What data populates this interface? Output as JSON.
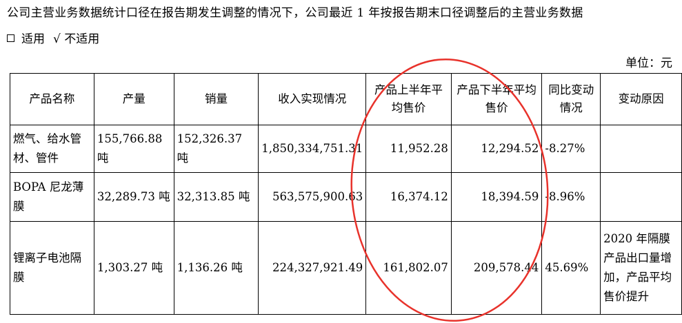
{
  "intro": "公司主营业务数据统计口径在报告期发生调整的情况下，公司最近 1 年按报告期末口径调整后的主营业务数据",
  "options": {
    "applicable_box": "□",
    "applicable": "适用",
    "not_applicable_mark": "√",
    "not_applicable": "不适用"
  },
  "unit_label": "单位：元",
  "table": {
    "headers": [
      "产品名称",
      "产量",
      "销量",
      "收入实现情况",
      "产品上半年平均售价",
      "产品下半年平均售价",
      "同比变动情况",
      "变动原因"
    ],
    "rows": [
      {
        "name": "燃气、给水管材、管件",
        "output": "155,766.88 吨",
        "sales": "152,326.37 吨",
        "revenue": "1,850,334,751.31",
        "h1_price": "11,952.28",
        "h2_price": "12,294.52",
        "yoy": "-8.27%",
        "reason": ""
      },
      {
        "name": "BOPA 尼龙薄膜",
        "output": "32,289.73 吨",
        "sales": "32,313.85 吨",
        "revenue": "563,575,900.63",
        "h1_price": "16,374.12",
        "h2_price": "18,394.59",
        "yoy": "-8.96%",
        "reason": ""
      },
      {
        "name": "锂离子电池隔膜",
        "output": "1,303.27 吨",
        "sales": "1,136.26 吨",
        "revenue": "224,327,921.49",
        "h1_price": "161,802.07",
        "h2_price": "209,578.44",
        "yoy": "45.69%",
        "reason": "2020 年隔膜产品出口量增加，产品平均售价提升"
      }
    ]
  },
  "annotation_color": "#e8322b"
}
